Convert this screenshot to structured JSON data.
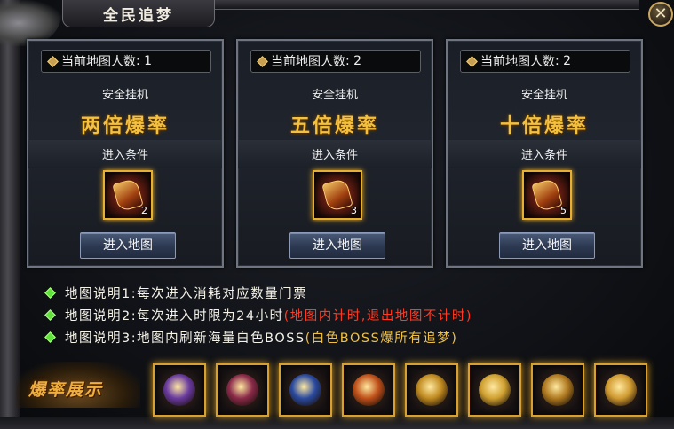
{
  "window": {
    "title": "全民追梦",
    "close_glyph": "✕"
  },
  "maps": [
    {
      "count_label": "当前地图人数",
      "count_value": "1",
      "mode": "安全挂机",
      "rate": "两倍爆率",
      "condition_label": "进入条件",
      "ticket_qty": "2",
      "button": "进入地图"
    },
    {
      "count_label": "当前地图人数",
      "count_value": "2",
      "mode": "安全挂机",
      "rate": "五倍爆率",
      "condition_label": "进入条件",
      "ticket_qty": "3",
      "button": "进入地图"
    },
    {
      "count_label": "当前地图人数",
      "count_value": "2",
      "mode": "安全挂机",
      "rate": "十倍爆率",
      "condition_label": "进入条件",
      "ticket_qty": "5",
      "button": "进入地图"
    }
  ],
  "notes": [
    {
      "prefix": "地图说明1:",
      "text": "每次进入消耗对应数量门票",
      "extra": ""
    },
    {
      "prefix": "地图说明2:",
      "text": "每次进入时限为24小时",
      "extra": "(地图内计时,退出地图不计时)"
    },
    {
      "prefix": "地图说明3:",
      "text": "地图内刷新海量白色BOSS",
      "extra": "(白色BOSS爆所有追梦)"
    }
  ],
  "showcase": {
    "label": "爆率展示",
    "items": [
      {
        "icon": "purple-armor-icon",
        "color": "#6a3aa0"
      },
      {
        "icon": "purple-red-armor-icon",
        "color": "#8a2a4a"
      },
      {
        "icon": "blue-armor-icon",
        "color": "#2a4aa0"
      },
      {
        "icon": "fire-orb-icon",
        "color": "#c0501a"
      },
      {
        "icon": "gold-helmet-icon",
        "color": "#c08a20"
      },
      {
        "icon": "gold-ring-icon",
        "color": "#d0a030"
      },
      {
        "icon": "gold-dragon-icon",
        "color": "#b07a20"
      },
      {
        "icon": "gold-crown-icon",
        "color": "#d09a30"
      }
    ]
  },
  "colors": {
    "rate_gold": "#f4c040",
    "note_red": "#ff3a20",
    "note_yellow": "#f0c040",
    "bullet_green": "#5fe23a"
  }
}
